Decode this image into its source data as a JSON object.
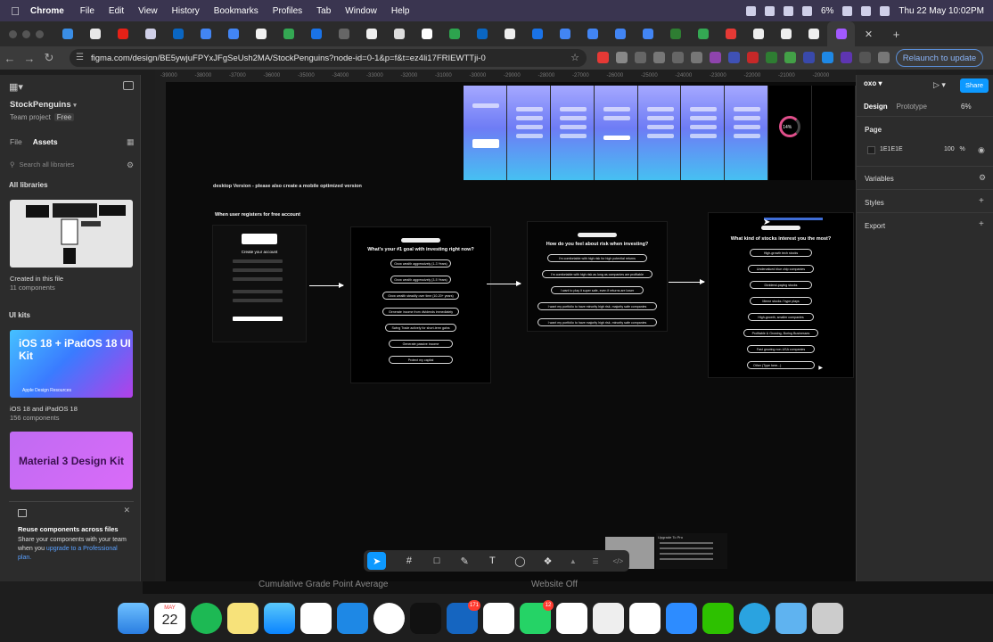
{
  "menubar": {
    "app": "Chrome",
    "items": [
      "File",
      "Edit",
      "View",
      "History",
      "Bookmarks",
      "Profiles",
      "Tab",
      "Window",
      "Help"
    ],
    "battery": "6%",
    "datetime": "Thu 22 May  10:02PM"
  },
  "browser": {
    "url": "figma.com/design/BE5ywjuFPYxJFgSeUsh2MA/StockPenguins?node-id=0-1&p=f&t=ez4li17FRIEWTTji-0",
    "relaunch_label": "Relaunch to update"
  },
  "left_panel": {
    "project_name": "StockPenguins",
    "team_label": "Team project",
    "plan_badge": "Free",
    "tab_file": "File",
    "tab_assets": "Assets",
    "search_placeholder": "Search all libraries",
    "all_libraries": "All libraries",
    "created_title": "Created in this file",
    "created_count": "11 components",
    "ui_kits": "UI kits",
    "kit1_thumb_title": "iOS 18 + iPadOS 18 UI Kit",
    "kit1_thumb_sub": "Apple Design Resources",
    "kit1_title": "iOS 18 and iPadOS 18",
    "kit1_count": "156 components",
    "kit2_thumb_title": "Material 3 Design Kit",
    "reuse_title": "Reuse components across files",
    "reuse_body": "Share your components with your team when you ",
    "reuse_link": "upgrade to a Professional plan."
  },
  "canvas": {
    "ruler_ticks": [
      "-39000",
      "-38000",
      "-37000",
      "-36000",
      "-35000",
      "-34000",
      "-33000",
      "-32000",
      "-31000",
      "-30000",
      "-29000",
      "-28000",
      "-27000",
      "-26000",
      "-25000",
      "-24000",
      "-23000",
      "-22000",
      "-21000",
      "-20000"
    ],
    "note": "desktop Version - please also create a mobile optimized version",
    "flow_title": "When user registers for free account",
    "register_title": "Create your account",
    "progress_label": "14%",
    "q1": {
      "title": "What's your #1 goal with investing right now?",
      "options": [
        "Grow wealth aggressively (1-3 Years)",
        "Grow wealth aggressively (3-5 Years)",
        "Grow wealth steadily over time (10-20+ years)",
        "Generate income from dividends immediately",
        "Swing Trade actively for short-term gains",
        "Generate passive income",
        "Protect my capital"
      ]
    },
    "q2": {
      "title": "How do you feel about risk when investing?",
      "options": [
        "I'm comfortable with high risk for high potential returns",
        "I'm comfortable with high risk as long as companies are profitable",
        "I want to play it super safe, even if returns are lower",
        "I want my portfolio to have minority high risk, majority safe companies",
        "I want my portfolio to have majority high risk, minority safe companies"
      ]
    },
    "q3": {
      "title": "What kind of stocks interest you the most?",
      "options": [
        "High-growth tech stocks",
        "Undervalued blue chip companies",
        "Dividend-paying stocks",
        "Meme stocks / hype plays",
        "High-growth, smaller companies",
        "Profitable & Growing, Boring Businesses",
        "Fast growing non-USA companies",
        "Other (Type here...)"
      ]
    },
    "mini_label": "Upgrade To Pro"
  },
  "right_panel": {
    "tab_design": "Design",
    "tab_prototype": "Prototype",
    "zoom": "6%",
    "share_label": "Share",
    "page_label": "Page",
    "page_color": "1E1E1E",
    "page_opacity": "100",
    "opacity_unit": "%",
    "variables": "Variables",
    "styles": "Styles",
    "export": "Export"
  },
  "behind_window": {
    "text1": "Cumulative Grade Point Average",
    "text2": "Website Off"
  },
  "dock": {
    "calendar_month": "MAY",
    "calendar_day": "22",
    "badge_trello": "171",
    "badge_whatsapp": "12"
  }
}
